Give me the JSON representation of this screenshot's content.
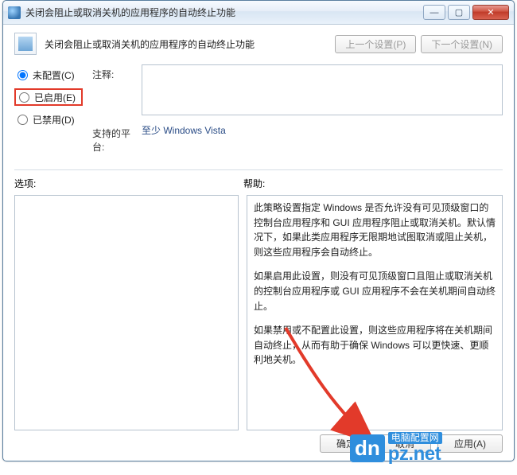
{
  "window": {
    "title": "关闭会阻止或取消关机的应用程序的自动终止功能"
  },
  "header": {
    "policy_title": "关闭会阻止或取消关机的应用程序的自动终止功能",
    "prev_btn": "上一个设置(P)",
    "next_btn": "下一个设置(N)"
  },
  "radios": {
    "not_configured": "未配置(C)",
    "enabled": "已启用(E)",
    "disabled": "已禁用(D)"
  },
  "fields": {
    "comment_label": "注释:",
    "comment_value": "",
    "platform_label": "支持的平台:",
    "platform_value": "至少 Windows Vista"
  },
  "labels": {
    "options": "选项:",
    "help": "帮助:"
  },
  "help": {
    "p1": "此策略设置指定 Windows 是否允许没有可见顶级窗口的控制台应用程序和 GUI 应用程序阻止或取消关机。默认情况下，如果此类应用程序无限期地试图取消或阻止关机，则这些应用程序会自动终止。",
    "p2": "如果启用此设置，则没有可见顶级窗口且阻止或取消关机的控制台应用程序或 GUI 应用程序不会在关机期间自动终止。",
    "p3": "如果禁用或不配置此设置，则这些应用程序将在关机期间自动终止，从而有助于确保 Windows 可以更快速、更顺利地关机。"
  },
  "footer": {
    "ok": "确定",
    "cancel": "取消",
    "apply": "应用(A)"
  },
  "overlay": {
    "badge": "dn",
    "cn": "电脑配置网",
    "domain": "pz.net"
  }
}
